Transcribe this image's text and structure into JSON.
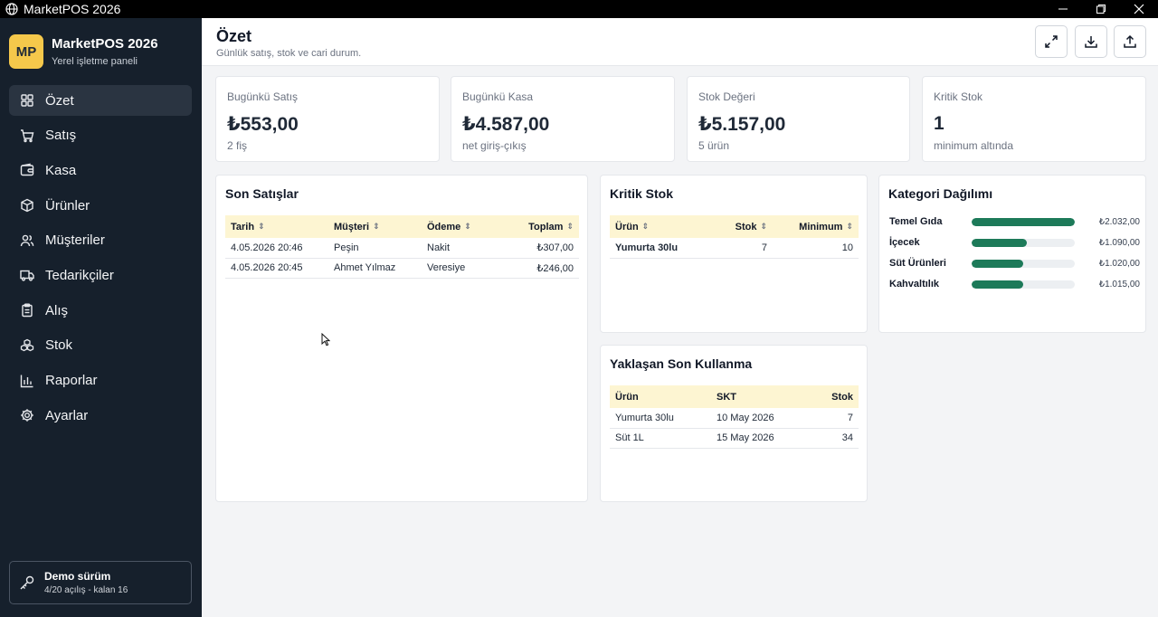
{
  "window": {
    "title": "MarketPOS 2026"
  },
  "brand": {
    "badge": "MP",
    "name": "MarketPOS 2026",
    "subtitle": "Yerel işletme paneli"
  },
  "nav": [
    {
      "label": "Özet",
      "icon": "grid-icon",
      "active": true
    },
    {
      "label": "Satış",
      "icon": "cart-icon"
    },
    {
      "label": "Kasa",
      "icon": "wallet-icon"
    },
    {
      "label": "Ürünler",
      "icon": "box-icon"
    },
    {
      "label": "Müşteriler",
      "icon": "users-icon"
    },
    {
      "label": "Tedarikçiler",
      "icon": "truck-icon"
    },
    {
      "label": "Alış",
      "icon": "clipboard-icon"
    },
    {
      "label": "Stok",
      "icon": "boxes-icon"
    },
    {
      "label": "Raporlar",
      "icon": "bar-chart-icon"
    },
    {
      "label": "Ayarlar",
      "icon": "gear-icon"
    }
  ],
  "demo": {
    "title": "Demo sürüm",
    "subtitle": "4/20 açılış - kalan 16"
  },
  "header": {
    "title": "Özet",
    "subtitle": "Günlük satış, stok ve cari durum."
  },
  "stats": [
    {
      "label": "Bugünkü Satış",
      "value": "₺553,00",
      "sub": "2 fiş"
    },
    {
      "label": "Bugünkü Kasa",
      "value": "₺4.587,00",
      "sub": "net giriş-çıkış"
    },
    {
      "label": "Stok Değeri",
      "value": "₺5.157,00",
      "sub": "5 ürün"
    },
    {
      "label": "Kritik Stok",
      "value": "1",
      "sub": "minimum altında"
    }
  ],
  "recent_sales": {
    "title": "Son Satışlar",
    "columns": [
      "Tarih",
      "Müşteri",
      "Ödeme",
      "Toplam"
    ],
    "rows": [
      [
        "4.05.2026 20:46",
        "Peşin",
        "Nakit",
        "₺307,00"
      ],
      [
        "4.05.2026 20:45",
        "Ahmet Yılmaz",
        "Veresiye",
        "₺246,00"
      ]
    ]
  },
  "critical_stock": {
    "title": "Kritik Stok",
    "columns": [
      "Ürün",
      "Stok",
      "Minimum"
    ],
    "rows": [
      [
        "Yumurta 30lu",
        "7",
        "10"
      ]
    ]
  },
  "expiry": {
    "title": "Yaklaşan Son Kullanma",
    "columns": [
      "Ürün",
      "SKT",
      "Stok"
    ],
    "rows": [
      [
        "Yumurta 30lu",
        "10 May 2026",
        "7"
      ],
      [
        "Süt 1L",
        "15 May 2026",
        "34"
      ]
    ]
  },
  "categories": {
    "title": "Kategori Dağılımı",
    "items": [
      {
        "name": "Temel Gıda",
        "value": "₺2.032,00",
        "share": 1.0
      },
      {
        "name": "İçecek",
        "value": "₺1.090,00",
        "share": 0.536
      },
      {
        "name": "Süt Ürünleri",
        "value": "₺1.020,00",
        "share": 0.502
      },
      {
        "name": "Kahvaltılık",
        "value": "₺1.015,00",
        "share": 0.5
      }
    ]
  },
  "colors": {
    "sidebar": "#16202c",
    "accent": "#f5c84b",
    "bar": "#1d7a59",
    "table_header": "#fdf5d2"
  }
}
